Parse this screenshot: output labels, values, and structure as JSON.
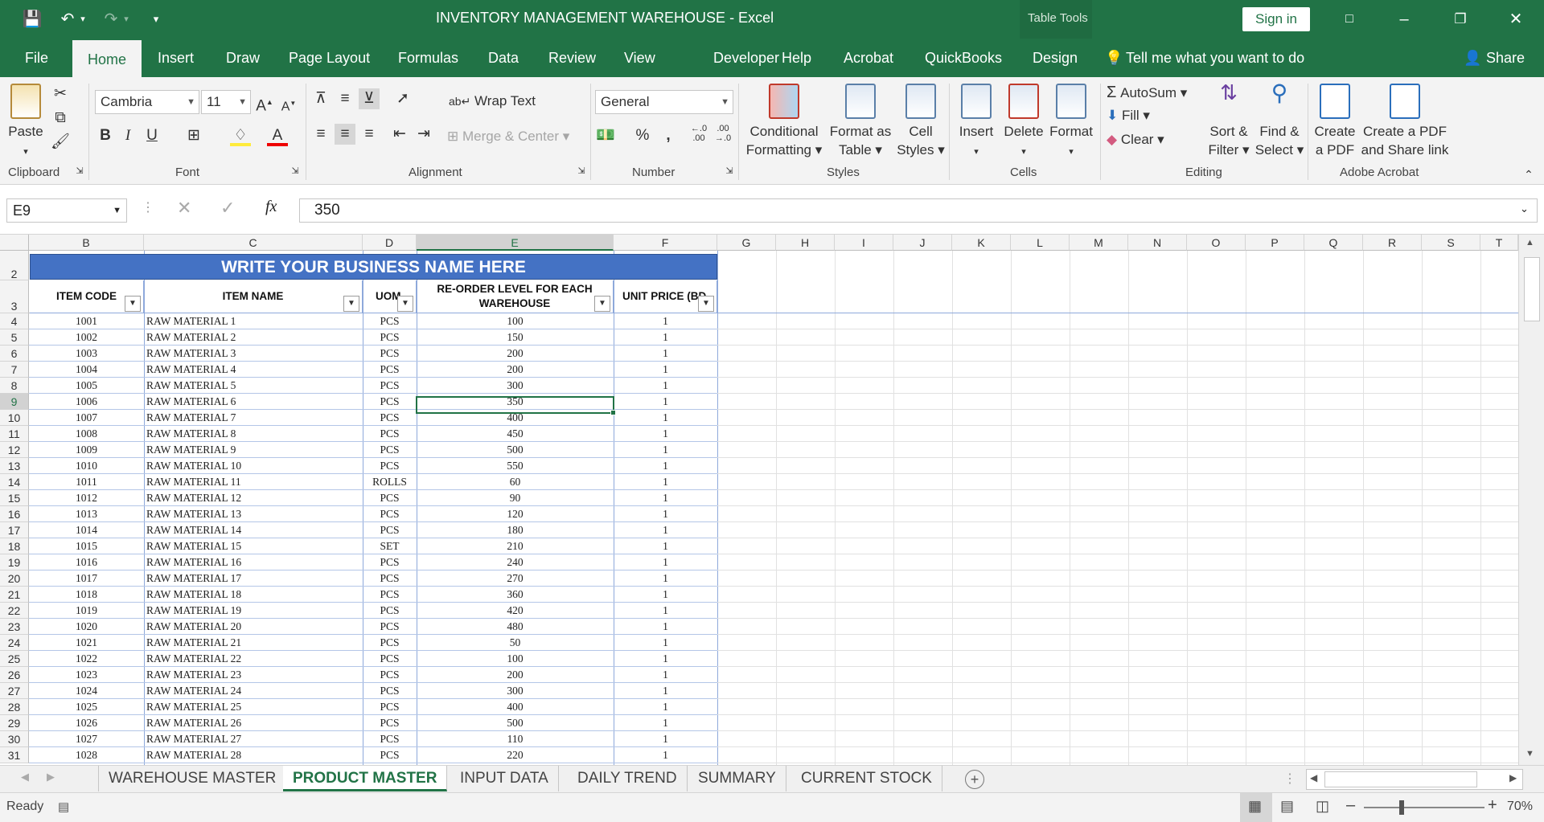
{
  "app": {
    "title": "INVENTORY MANAGEMENT WAREHOUSE  -  Excel",
    "context_tab": "Table Tools",
    "signin": "Sign in"
  },
  "tabs": [
    "File",
    "Home",
    "Insert",
    "Draw",
    "Page Layout",
    "Formulas",
    "Data",
    "Review",
    "View",
    "Developer",
    "Help",
    "Acrobat",
    "QuickBooks",
    "Design"
  ],
  "tell_me": "Tell me what you want to do",
  "share": "Share",
  "ribbon": {
    "paste": "Paste",
    "font_name": "Cambria",
    "font_size": "11",
    "wrap_text": "Wrap Text",
    "merge_center": "Merge & Center",
    "number_format": "General",
    "conditional_formatting": [
      "Conditional",
      "Formatting"
    ],
    "format_as_table": [
      "Format as",
      "Table"
    ],
    "cell_styles": [
      "Cell",
      "Styles"
    ],
    "insert": "Insert",
    "delete": "Delete",
    "format": "Format",
    "autosum": "AutoSum",
    "fill": "Fill",
    "clear": "Clear",
    "sort_filter": [
      "Sort &",
      "Filter"
    ],
    "find_select": [
      "Find &",
      "Select"
    ],
    "create_pdf": [
      "Create",
      "a PDF"
    ],
    "create_share": [
      "Create a PDF",
      "and Share link"
    ],
    "groups": [
      "Clipboard",
      "Font",
      "Alignment",
      "Number",
      "Styles",
      "Cells",
      "Editing",
      "Adobe Acrobat"
    ]
  },
  "formula_bar": {
    "name_box": "E9",
    "value": "350"
  },
  "columns": [
    "B",
    "C",
    "D",
    "E",
    "F",
    "G",
    "H",
    "I",
    "J",
    "K",
    "L",
    "M",
    "N",
    "O",
    "P",
    "Q",
    "R",
    "S",
    "T"
  ],
  "sheet": {
    "banner": "WRITE YOUR BUSINESS NAME HERE",
    "headers": {
      "item_code": "ITEM CODE",
      "item_name": "ITEM NAME",
      "uom": "UOM",
      "reorder_1": "RE-ORDER LEVEL FOR EACH",
      "reorder_2": "WAREHOUSE",
      "unit_price": "UNIT PRICE (BD"
    },
    "header_row_nums": [
      "2",
      "3"
    ],
    "rows": [
      {
        "n": "4",
        "code": "1001",
        "name": "RAW MATERIAL 1",
        "uom": "PCS",
        "reorder": "100",
        "price": "1"
      },
      {
        "n": "5",
        "code": "1002",
        "name": "RAW MATERIAL 2",
        "uom": "PCS",
        "reorder": "150",
        "price": "1"
      },
      {
        "n": "6",
        "code": "1003",
        "name": "RAW MATERIAL 3",
        "uom": "PCS",
        "reorder": "200",
        "price": "1"
      },
      {
        "n": "7",
        "code": "1004",
        "name": "RAW MATERIAL 4",
        "uom": "PCS",
        "reorder": "200",
        "price": "1"
      },
      {
        "n": "8",
        "code": "1005",
        "name": "RAW MATERIAL 5",
        "uom": "PCS",
        "reorder": "300",
        "price": "1"
      },
      {
        "n": "9",
        "code": "1006",
        "name": "RAW MATERIAL 6",
        "uom": "PCS",
        "reorder": "350",
        "price": "1"
      },
      {
        "n": "10",
        "code": "1007",
        "name": "RAW MATERIAL 7",
        "uom": "PCS",
        "reorder": "400",
        "price": "1"
      },
      {
        "n": "11",
        "code": "1008",
        "name": "RAW MATERIAL 8",
        "uom": "PCS",
        "reorder": "450",
        "price": "1"
      },
      {
        "n": "12",
        "code": "1009",
        "name": "RAW MATERIAL 9",
        "uom": "PCS",
        "reorder": "500",
        "price": "1"
      },
      {
        "n": "13",
        "code": "1010",
        "name": "RAW MATERIAL 10",
        "uom": "PCS",
        "reorder": "550",
        "price": "1"
      },
      {
        "n": "14",
        "code": "1011",
        "name": "RAW MATERIAL 11",
        "uom": "ROLLS",
        "reorder": "60",
        "price": "1"
      },
      {
        "n": "15",
        "code": "1012",
        "name": "RAW MATERIAL 12",
        "uom": "PCS",
        "reorder": "90",
        "price": "1"
      },
      {
        "n": "16",
        "code": "1013",
        "name": "RAW MATERIAL 13",
        "uom": "PCS",
        "reorder": "120",
        "price": "1"
      },
      {
        "n": "17",
        "code": "1014",
        "name": "RAW MATERIAL 14",
        "uom": "PCS",
        "reorder": "180",
        "price": "1"
      },
      {
        "n": "18",
        "code": "1015",
        "name": "RAW MATERIAL 15",
        "uom": "SET",
        "reorder": "210",
        "price": "1"
      },
      {
        "n": "19",
        "code": "1016",
        "name": "RAW MATERIAL 16",
        "uom": "PCS",
        "reorder": "240",
        "price": "1"
      },
      {
        "n": "20",
        "code": "1017",
        "name": "RAW MATERIAL 17",
        "uom": "PCS",
        "reorder": "270",
        "price": "1"
      },
      {
        "n": "21",
        "code": "1018",
        "name": "RAW MATERIAL 18",
        "uom": "PCS",
        "reorder": "360",
        "price": "1"
      },
      {
        "n": "22",
        "code": "1019",
        "name": "RAW MATERIAL 19",
        "uom": "PCS",
        "reorder": "420",
        "price": "1"
      },
      {
        "n": "23",
        "code": "1020",
        "name": "RAW MATERIAL 20",
        "uom": "PCS",
        "reorder": "480",
        "price": "1"
      },
      {
        "n": "24",
        "code": "1021",
        "name": "RAW MATERIAL 21",
        "uom": "PCS",
        "reorder": "50",
        "price": "1"
      },
      {
        "n": "25",
        "code": "1022",
        "name": "RAW MATERIAL 22",
        "uom": "PCS",
        "reorder": "100",
        "price": "1"
      },
      {
        "n": "26",
        "code": "1023",
        "name": "RAW MATERIAL 23",
        "uom": "PCS",
        "reorder": "200",
        "price": "1"
      },
      {
        "n": "27",
        "code": "1024",
        "name": "RAW MATERIAL 24",
        "uom": "PCS",
        "reorder": "300",
        "price": "1"
      },
      {
        "n": "28",
        "code": "1025",
        "name": "RAW MATERIAL 25",
        "uom": "PCS",
        "reorder": "400",
        "price": "1"
      },
      {
        "n": "29",
        "code": "1026",
        "name": "RAW MATERIAL 26",
        "uom": "PCS",
        "reorder": "500",
        "price": "1"
      },
      {
        "n": "30",
        "code": "1027",
        "name": "RAW MATERIAL 27",
        "uom": "PCS",
        "reorder": "110",
        "price": "1"
      },
      {
        "n": "31",
        "code": "1028",
        "name": "RAW MATERIAL 28",
        "uom": "PCS",
        "reorder": "220",
        "price": "1"
      }
    ]
  },
  "sheet_tabs": [
    "WAREHOUSE MASTER",
    "PRODUCT MASTER",
    "INPUT DATA",
    "DAILY TREND",
    "SUMMARY",
    "CURRENT STOCK"
  ],
  "active_sheet": "PRODUCT MASTER",
  "status": {
    "ready": "Ready",
    "zoom": "70%"
  },
  "colors": {
    "excel_green": "#217346",
    "banner_blue": "#4472c4"
  }
}
